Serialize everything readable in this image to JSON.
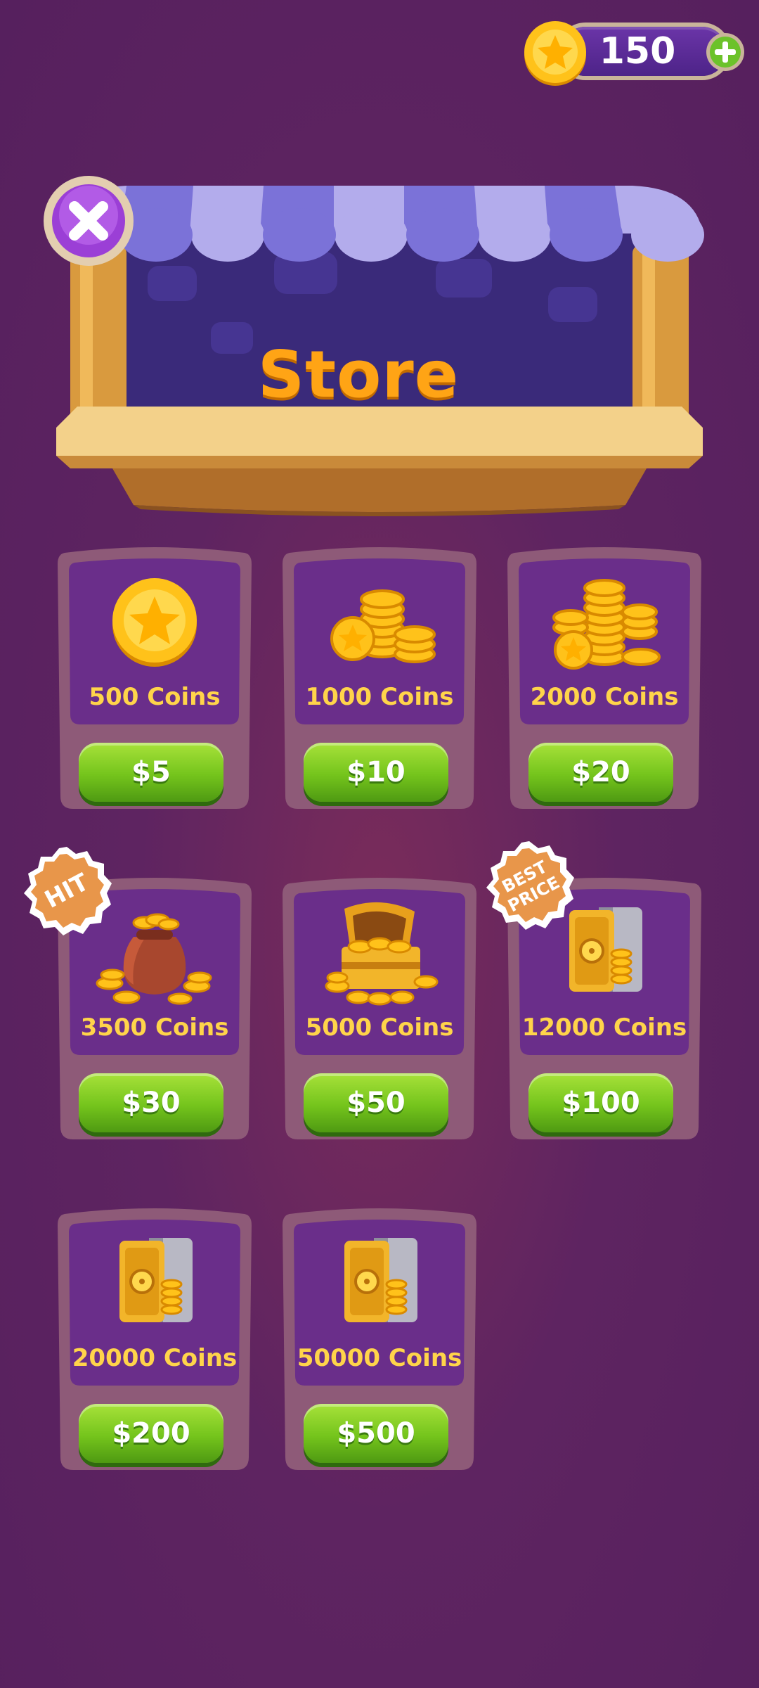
{
  "balance": {
    "value": "150",
    "coin_icon": "gold-coin-icon",
    "add_icon": "plus-icon"
  },
  "header": {
    "title": "Store",
    "close_icon": "close-icon"
  },
  "products": [
    {
      "label": "500 Coins",
      "price": "$5",
      "icon": "single-coin-icon",
      "badge": ""
    },
    {
      "label": "1000 Coins",
      "price": "$10",
      "icon": "coin-stack-icon",
      "badge": ""
    },
    {
      "label": "2000 Coins",
      "price": "$20",
      "icon": "coin-pile-icon",
      "badge": ""
    },
    {
      "label": "3500 Coins",
      "price": "$30",
      "icon": "coin-bag-icon",
      "badge": "HIT"
    },
    {
      "label": "5000 Coins",
      "price": "$50",
      "icon": "treasure-chest-icon",
      "badge": ""
    },
    {
      "label": "12000 Coins",
      "price": "$100",
      "icon": "safe-icon",
      "badge": "BEST\nPRICE"
    },
    {
      "label": "20000 Coins",
      "price": "$200",
      "icon": "safe-icon",
      "badge": ""
    },
    {
      "label": "50000 Coins",
      "price": "$500",
      "icon": "safe-icon",
      "badge": ""
    }
  ],
  "colors": {
    "background": "#5e2461",
    "title": "#ffa415",
    "coin_label": "#ffd44a",
    "price_button": "#74c41c",
    "badge": "#e8964a",
    "close_button": "#9b3fd6"
  }
}
